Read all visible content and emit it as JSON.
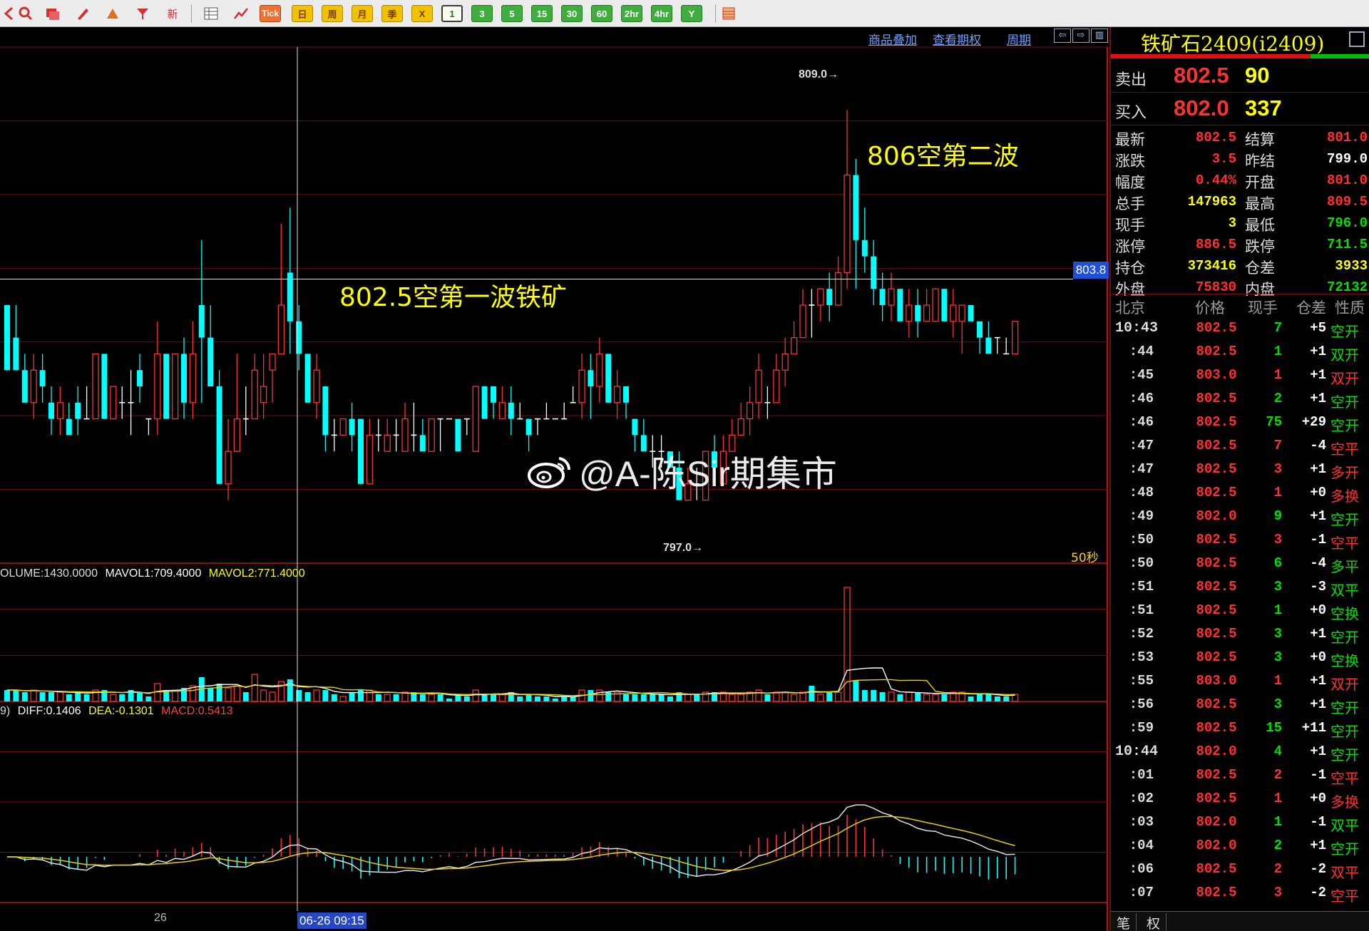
{
  "toolbar": {
    "icons": [
      "back-icon",
      "search-icon",
      "window-icon",
      "pen-icon",
      "draw-icon",
      "filter-icon",
      "new-icon",
      "table-icon",
      "chart-icon"
    ],
    "tick_label": "Tick",
    "periods": [
      "日",
      "周",
      "月",
      "季",
      "X",
      "1",
      "3",
      "5",
      "15",
      "30",
      "60",
      "2hr",
      "4hr",
      "Y"
    ],
    "selected_period": "1"
  },
  "chart_header": {
    "links": [
      "商品叠加",
      "查看期权",
      "周期"
    ]
  },
  "annotations": {
    "wave1": "802.5空第一波铁矿",
    "wave2": "806空第二波",
    "peak_high": "809.0→",
    "peak_low": "797.0→",
    "price_tag": "803.8",
    "interval": "50秒",
    "x_tick": "26",
    "date_tag": "06-26 09:15",
    "watermark": "@A-陈Sir期集市"
  },
  "volume_legend": {
    "volume": "OLUME:1430.0000",
    "mavol1": "MAVOL1:709.4000",
    "mavol2": "MAVOL2:771.4000"
  },
  "macd_legend": {
    "prefix": "9)",
    "diff": "DIFF:0.1406",
    "dea": "DEA:-0.1301",
    "macd": "MACD:0.5413"
  },
  "colors": {
    "up": "#ff3030",
    "down": "#00ffff",
    "flat": "#ffffff",
    "grid": "#7a0a0a",
    "yellow": "#ffff00",
    "green": "#00e000"
  },
  "chart_data": {
    "type": "candlestick",
    "price_range": [
      795.5,
      810.5
    ],
    "candles": [
      [
        803.0,
        803.0,
        801.0,
        801.0
      ],
      [
        802.0,
        803.0,
        801.0,
        801.0
      ],
      [
        801.0,
        801.5,
        800.0,
        800.0
      ],
      [
        800.0,
        801.5,
        799.5,
        801.0
      ],
      [
        801.0,
        801.5,
        800.0,
        800.5
      ],
      [
        800.0,
        800.5,
        799.0,
        799.5
      ],
      [
        799.5,
        800.5,
        799.0,
        800.0
      ],
      [
        799.5,
        800.0,
        799.0,
        799.0
      ],
      [
        800.0,
        800.5,
        799.0,
        799.5
      ],
      [
        799.5,
        800.5,
        799.5,
        799.5
      ],
      [
        799.5,
        801.5,
        799.5,
        801.5
      ],
      [
        801.5,
        801.5,
        799.5,
        799.5
      ],
      [
        799.5,
        800.5,
        799.5,
        800.5
      ],
      [
        800.0,
        800.5,
        799.5,
        800.0
      ],
      [
        800.0,
        801.0,
        799.0,
        800.0
      ],
      [
        801.0,
        801.5,
        800.0,
        800.5
      ],
      [
        799.5,
        799.5,
        799.0,
        799.5
      ],
      [
        799.5,
        802.5,
        799.0,
        801.5
      ],
      [
        801.5,
        801.5,
        799.5,
        799.5
      ],
      [
        799.5,
        801.5,
        799.5,
        801.5
      ],
      [
        801.5,
        802.0,
        799.5,
        800.0
      ],
      [
        800.0,
        802.5,
        799.5,
        801.5
      ],
      [
        803.0,
        805.0,
        800.0,
        802.0
      ],
      [
        802.0,
        803.0,
        800.5,
        800.5
      ],
      [
        800.5,
        801.0,
        797.5,
        797.5
      ],
      [
        797.5,
        799.5,
        797.0,
        798.5
      ],
      [
        798.5,
        801.5,
        798.5,
        799.5
      ],
      [
        799.5,
        800.5,
        799.0,
        799.5
      ],
      [
        799.5,
        801.5,
        799.5,
        801.0
      ],
      [
        800.0,
        801.5,
        799.5,
        800.5
      ],
      [
        801.0,
        801.5,
        800.0,
        801.5
      ],
      [
        801.5,
        805.5,
        801.5,
        803.0
      ],
      [
        804.0,
        806.0,
        801.5,
        802.5
      ],
      [
        802.5,
        803.0,
        801.0,
        801.5
      ],
      [
        801.5,
        801.5,
        800.0,
        800.0
      ],
      [
        800.0,
        801.5,
        799.5,
        801.0
      ],
      [
        800.5,
        800.5,
        798.5,
        799.0
      ],
      [
        799.0,
        799.5,
        798.5,
        799.0
      ],
      [
        799.0,
        799.5,
        799.0,
        799.5
      ],
      [
        799.5,
        800.0,
        798.5,
        799.0
      ],
      [
        799.5,
        799.5,
        797.5,
        797.5
      ],
      [
        797.5,
        799.5,
        797.5,
        799.0
      ],
      [
        799.0,
        799.5,
        798.5,
        799.0
      ],
      [
        798.5,
        799.5,
        798.5,
        799.0
      ],
      [
        799.0,
        799.5,
        798.5,
        799.0
      ],
      [
        798.5,
        800.0,
        798.5,
        799.5
      ],
      [
        799.0,
        800.0,
        798.5,
        799.0
      ],
      [
        799.0,
        799.5,
        798.5,
        798.5
      ],
      [
        798.5,
        799.5,
        798.5,
        799.5
      ],
      [
        799.5,
        799.5,
        798.5,
        799.5
      ],
      [
        799.5,
        799.5,
        799.5,
        799.5
      ],
      [
        799.5,
        799.5,
        798.5,
        798.5
      ],
      [
        799.5,
        799.5,
        799.0,
        799.5
      ],
      [
        798.5,
        800.5,
        798.5,
        800.5
      ],
      [
        800.5,
        800.5,
        799.5,
        799.5
      ],
      [
        800.5,
        800.5,
        799.5,
        800.0
      ],
      [
        799.5,
        800.5,
        799.5,
        800.0
      ],
      [
        800.0,
        800.5,
        799.0,
        799.5
      ],
      [
        799.5,
        800.0,
        799.5,
        799.5
      ],
      [
        799.5,
        799.5,
        798.5,
        799.0
      ],
      [
        799.5,
        799.5,
        799.0,
        799.5
      ],
      [
        799.5,
        800.0,
        799.5,
        799.5
      ],
      [
        799.5,
        799.5,
        799.5,
        799.5
      ],
      [
        799.5,
        800.0,
        799.5,
        799.5
      ],
      [
        800.0,
        800.5,
        800.0,
        800.0
      ],
      [
        800.0,
        801.5,
        799.5,
        801.0
      ],
      [
        801.0,
        801.5,
        799.5,
        800.5
      ],
      [
        800.5,
        802.0,
        800.0,
        801.5
      ],
      [
        801.5,
        801.5,
        800.0,
        800.0
      ],
      [
        800.0,
        801.0,
        799.5,
        800.5
      ],
      [
        800.5,
        800.5,
        799.5,
        800.0
      ],
      [
        799.5,
        799.5,
        798.5,
        799.0
      ],
      [
        799.0,
        799.5,
        798.5,
        798.5
      ],
      [
        798.5,
        799.0,
        798.0,
        798.5
      ],
      [
        798.5,
        799.0,
        798.0,
        798.5
      ],
      [
        798.5,
        798.5,
        798.0,
        798.0
      ],
      [
        798.0,
        798.5,
        797.0,
        797.0
      ],
      [
        797.0,
        798.0,
        797.0,
        797.5
      ],
      [
        797.5,
        798.0,
        797.0,
        797.5
      ],
      [
        797.0,
        798.5,
        797.0,
        798.5
      ],
      [
        798.5,
        799.0,
        797.5,
        798.0
      ],
      [
        797.5,
        799.0,
        797.5,
        798.5
      ],
      [
        798.5,
        799.5,
        798.5,
        799.0
      ],
      [
        799.0,
        800.0,
        799.0,
        799.5
      ],
      [
        799.5,
        800.5,
        799.0,
        800.0
      ],
      [
        800.0,
        801.5,
        799.5,
        801.0
      ],
      [
        800.0,
        800.5,
        799.5,
        800.0
      ],
      [
        800.0,
        801.5,
        800.0,
        801.0
      ],
      [
        801.0,
        802.0,
        800.5,
        801.5
      ],
      [
        801.5,
        802.5,
        801.5,
        802.0
      ],
      [
        802.0,
        803.5,
        802.0,
        803.0
      ],
      [
        803.0,
        803.5,
        802.0,
        803.0
      ],
      [
        803.0,
        803.5,
        802.5,
        803.5
      ],
      [
        803.5,
        804.0,
        802.5,
        803.0
      ],
      [
        803.0,
        804.5,
        803.0,
        804.0
      ],
      [
        804.0,
        809.0,
        803.5,
        807.0
      ],
      [
        807.0,
        807.5,
        803.5,
        805.0
      ],
      [
        805.0,
        806.0,
        804.0,
        804.5
      ],
      [
        804.5,
        805.0,
        803.0,
        803.5
      ],
      [
        803.5,
        804.0,
        802.5,
        803.0
      ],
      [
        803.0,
        804.0,
        802.5,
        803.5
      ],
      [
        803.5,
        803.5,
        802.5,
        802.5
      ],
      [
        802.5,
        803.5,
        802.0,
        803.0
      ],
      [
        803.0,
        803.5,
        802.0,
        802.5
      ],
      [
        802.5,
        803.5,
        802.5,
        803.0
      ],
      [
        802.5,
        803.5,
        802.5,
        803.5
      ],
      [
        803.5,
        803.5,
        802.5,
        802.5
      ],
      [
        802.5,
        803.5,
        802.0,
        803.0
      ],
      [
        802.5,
        803.0,
        801.5,
        803.0
      ],
      [
        803.0,
        803.0,
        802.5,
        802.5
      ],
      [
        802.5,
        802.5,
        801.5,
        802.0
      ],
      [
        802.0,
        802.5,
        801.5,
        801.5
      ],
      [
        802.0,
        802.0,
        801.5,
        802.0
      ],
      [
        801.5,
        802.0,
        801.5,
        801.5
      ],
      [
        801.5,
        802.5,
        801.5,
        802.5
      ]
    ]
  },
  "quote": {
    "title": "铁矿石2409(i2409)",
    "sell_label": "卖出",
    "sell_price": "802.5",
    "sell_qty": "90",
    "buy_label": "买入",
    "buy_price": "802.0",
    "buy_qty": "337",
    "stats": [
      {
        "l1": "最新",
        "v1": "802.5",
        "c1": "#ff3030",
        "l2": "结算",
        "v2": "801.0",
        "c2": "#ff3030"
      },
      {
        "l1": "涨跌",
        "v1": "3.5",
        "c1": "#ff3030",
        "l2": "昨结",
        "v2": "799.0",
        "c2": "#ffffff"
      },
      {
        "l1": "幅度",
        "v1": "0.44%",
        "c1": "#ff3030",
        "l2": "开盘",
        "v2": "801.0",
        "c2": "#ff3030"
      },
      {
        "l1": "总手",
        "v1": "147963",
        "c1": "#ffff00",
        "l2": "最高",
        "v2": "809.5",
        "c2": "#ff3030"
      },
      {
        "l1": "现手",
        "v1": "3",
        "c1": "#ffff00",
        "l2": "最低",
        "v2": "796.0",
        "c2": "#00e000"
      },
      {
        "l1": "涨停",
        "v1": "886.5",
        "c1": "#ff3030",
        "l2": "跌停",
        "v2": "711.5",
        "c2": "#00e000"
      },
      {
        "l1": "持仓",
        "v1": "373416",
        "c1": "#ffff00",
        "l2": "仓差",
        "v2": "3933",
        "c2": "#ffff00"
      },
      {
        "l1": "外盘",
        "v1": "75830",
        "c1": "#ff3030",
        "l2": "内盘",
        "v2": "72132",
        "c2": "#00e000"
      }
    ],
    "tick_headers": [
      "北京",
      "价格",
      "现手",
      "仓差",
      "性质"
    ],
    "ticks": [
      {
        "t": "10:43",
        "p": "802.5",
        "pc": "#ff3030",
        "v": "7",
        "vc": "#00e000",
        "c": "+5",
        "ty": "空开",
        "tc": "#00e000",
        "big": true
      },
      {
        "t": ":44",
        "p": "802.5",
        "pc": "#ff3030",
        "v": "1",
        "vc": "#00e000",
        "c": "+1",
        "ty": "双开",
        "tc": "#00e000"
      },
      {
        "t": ":45",
        "p": "803.0",
        "pc": "#ff3030",
        "v": "1",
        "vc": "#ff3030",
        "c": "+1",
        "ty": "双开",
        "tc": "#ff3030"
      },
      {
        "t": ":46",
        "p": "802.5",
        "pc": "#ff3030",
        "v": "2",
        "vc": "#00e000",
        "c": "+1",
        "ty": "空开",
        "tc": "#00e000"
      },
      {
        "t": ":46",
        "p": "802.5",
        "pc": "#ff3030",
        "v": "75",
        "vc": "#00e000",
        "c": "+29",
        "ty": "空开",
        "tc": "#00e000"
      },
      {
        "t": ":47",
        "p": "802.5",
        "pc": "#ff3030",
        "v": "7",
        "vc": "#ff3030",
        "c": "-4",
        "ty": "空平",
        "tc": "#ff3030"
      },
      {
        "t": ":47",
        "p": "802.5",
        "pc": "#ff3030",
        "v": "3",
        "vc": "#ff3030",
        "c": "+1",
        "ty": "多开",
        "tc": "#ff3030"
      },
      {
        "t": ":48",
        "p": "802.5",
        "pc": "#ff3030",
        "v": "1",
        "vc": "#ff3030",
        "c": "+0",
        "ty": "多换",
        "tc": "#ff3030"
      },
      {
        "t": ":49",
        "p": "802.0",
        "pc": "#ff3030",
        "v": "9",
        "vc": "#00e000",
        "c": "+1",
        "ty": "空开",
        "tc": "#00e000"
      },
      {
        "t": ":50",
        "p": "802.5",
        "pc": "#ff3030",
        "v": "3",
        "vc": "#ff3030",
        "c": "-1",
        "ty": "空平",
        "tc": "#ff3030"
      },
      {
        "t": ":50",
        "p": "802.5",
        "pc": "#ff3030",
        "v": "6",
        "vc": "#00e000",
        "c": "-4",
        "ty": "多平",
        "tc": "#00e000"
      },
      {
        "t": ":51",
        "p": "802.5",
        "pc": "#ff3030",
        "v": "3",
        "vc": "#00e000",
        "c": "-3",
        "ty": "双平",
        "tc": "#00e000"
      },
      {
        "t": ":51",
        "p": "802.5",
        "pc": "#ff3030",
        "v": "1",
        "vc": "#00e000",
        "c": "+0",
        "ty": "空换",
        "tc": "#00e000"
      },
      {
        "t": ":52",
        "p": "802.5",
        "pc": "#ff3030",
        "v": "3",
        "vc": "#00e000",
        "c": "+1",
        "ty": "空开",
        "tc": "#00e000"
      },
      {
        "t": ":53",
        "p": "802.5",
        "pc": "#ff3030",
        "v": "3",
        "vc": "#00e000",
        "c": "+0",
        "ty": "空换",
        "tc": "#00e000"
      },
      {
        "t": ":55",
        "p": "803.0",
        "pc": "#ff3030",
        "v": "1",
        "vc": "#ff3030",
        "c": "+1",
        "ty": "双开",
        "tc": "#ff3030"
      },
      {
        "t": ":56",
        "p": "802.5",
        "pc": "#ff3030",
        "v": "3",
        "vc": "#00e000",
        "c": "+1",
        "ty": "空开",
        "tc": "#00e000"
      },
      {
        "t": ":59",
        "p": "802.5",
        "pc": "#ff3030",
        "v": "15",
        "vc": "#00e000",
        "c": "+11",
        "ty": "空开",
        "tc": "#00e000"
      },
      {
        "t": "10:44",
        "p": "802.0",
        "pc": "#ff3030",
        "v": "4",
        "vc": "#00e000",
        "c": "+1",
        "ty": "空开",
        "tc": "#00e000",
        "big": true
      },
      {
        "t": ":01",
        "p": "802.5",
        "pc": "#ff3030",
        "v": "2",
        "vc": "#ff3030",
        "c": "-1",
        "ty": "空平",
        "tc": "#ff3030"
      },
      {
        "t": ":02",
        "p": "802.5",
        "pc": "#ff3030",
        "v": "1",
        "vc": "#ff3030",
        "c": "+0",
        "ty": "多换",
        "tc": "#ff3030"
      },
      {
        "t": ":03",
        "p": "802.0",
        "pc": "#ff3030",
        "v": "1",
        "vc": "#00e000",
        "c": "-1",
        "ty": "双平",
        "tc": "#00e000"
      },
      {
        "t": ":04",
        "p": "802.0",
        "pc": "#ff3030",
        "v": "2",
        "vc": "#00e000",
        "c": "+1",
        "ty": "空开",
        "tc": "#00e000"
      },
      {
        "t": ":06",
        "p": "802.5",
        "pc": "#ff3030",
        "v": "2",
        "vc": "#ff3030",
        "c": "-2",
        "ty": "双平",
        "tc": "#ff3030"
      },
      {
        "t": ":07",
        "p": "802.5",
        "pc": "#ff3030",
        "v": "3",
        "vc": "#ff3030",
        "c": "-2",
        "ty": "空平",
        "tc": "#ff3030"
      }
    ],
    "tabs": [
      "笔",
      "权"
    ]
  }
}
